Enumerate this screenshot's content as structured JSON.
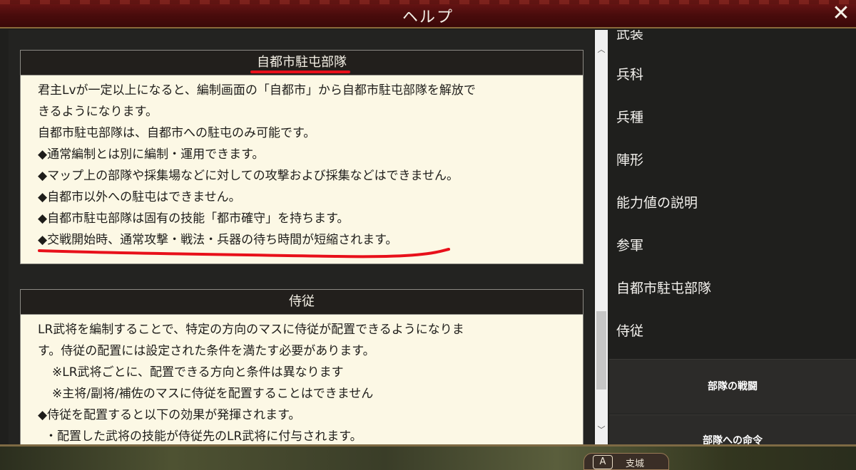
{
  "window": {
    "title": "ヘルプ",
    "close_label": "✕"
  },
  "sections": [
    {
      "header": "自都市駐屯部隊",
      "lines": [
        "君主Lvが一定以上になると、編制画面の「自都市」から自都市駐屯部隊を解放で",
        "きるようになります。",
        "自都市駐屯部隊は、自都市への駐屯のみ可能です。",
        "◆通常編制とは別に編制・運用できます。",
        "◆マップ上の部隊や採集場などに対しての攻撃および採集などはできません。",
        "◆自都市以外への駐屯はできません。",
        "◆自都市駐屯部隊は固有の技能「都市確守」を持ちます。",
        "◆交戦開始時、通常攻撃・戦法・兵器の待ち時間が短縮されます。"
      ]
    },
    {
      "header": "侍従",
      "lines": [
        "LR武将を編制することで、特定の方向のマスに侍従が配置できるようになりま",
        "す。侍従の配置には設定された条件を満たす必要があります。",
        "※LR武将ごとに、配置できる方向と条件は異なります",
        "※主将/副将/補佐のマスに侍従を配置することはできません",
        "◆侍従を配置すると以下の効果が発揮されます。",
        "・配置した武将の技能が侍従先のLR武将に付与されます。"
      ]
    }
  ],
  "nav": {
    "items": [
      "武装",
      "兵科",
      "兵種",
      "陣形",
      "能力値の説明",
      "参軍",
      "自都市駐屯部隊",
      "侍従"
    ],
    "buttons": [
      "部隊の戦闘",
      "部隊への命令"
    ]
  },
  "bottom_bar": {
    "branch_key": "A",
    "branch_label": "支城"
  },
  "colors": {
    "titlebar": "#5a0f0f",
    "panel": "#fcf8e5",
    "header": "#221f1c",
    "highlight": "#e8101a"
  }
}
